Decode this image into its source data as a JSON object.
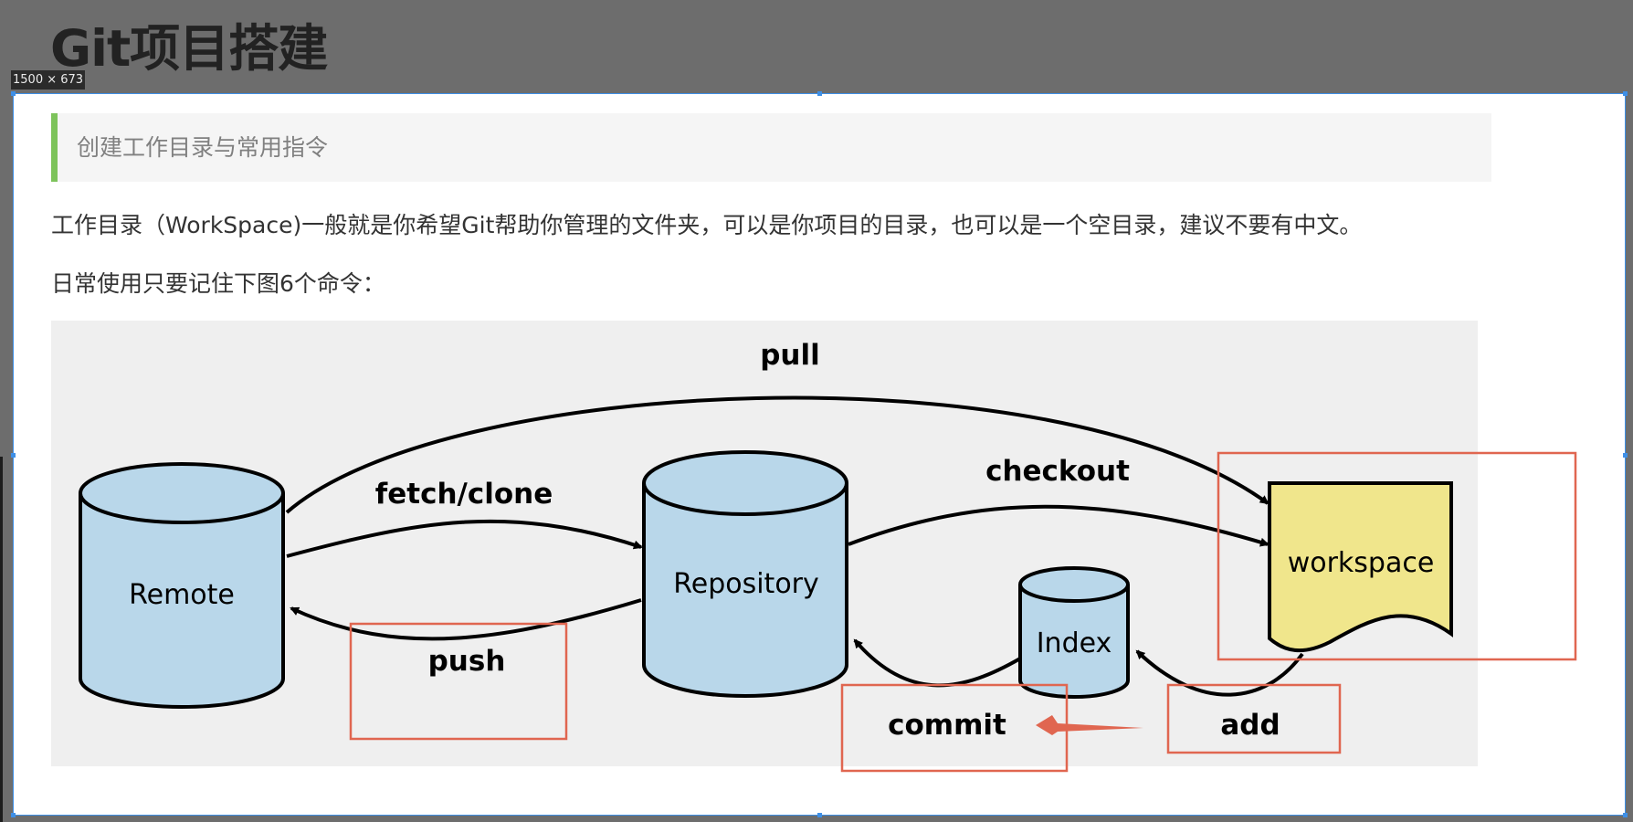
{
  "header": {
    "title": "Git项目搭建",
    "image_size_tag": "1500 × 673"
  },
  "article": {
    "quote": "创建工作目录与常用指令",
    "paragraph_1": "工作目录（WorkSpace)一般就是你希望Git帮助你管理的文件夹，可以是你项目的目录，也可以是一个空目录，建议不要有中文。",
    "paragraph_2": "日常使用只要记住下图6个命令："
  },
  "diagram": {
    "nodes": {
      "remote": "Remote",
      "repository": "Repository",
      "index": "Index",
      "workspace": "workspace"
    },
    "commands": {
      "pull": "pull",
      "fetch_clone": "fetch/clone",
      "checkout": "checkout",
      "push": "push",
      "commit": "commit",
      "add": "add"
    },
    "colors": {
      "cylinder_fill": "#b9d7ea",
      "workspace_fill": "#f0e68c",
      "annotation_red": "#e06650",
      "quote_accent": "#7dc35b",
      "selection_blue": "#3e8fe6"
    }
  }
}
